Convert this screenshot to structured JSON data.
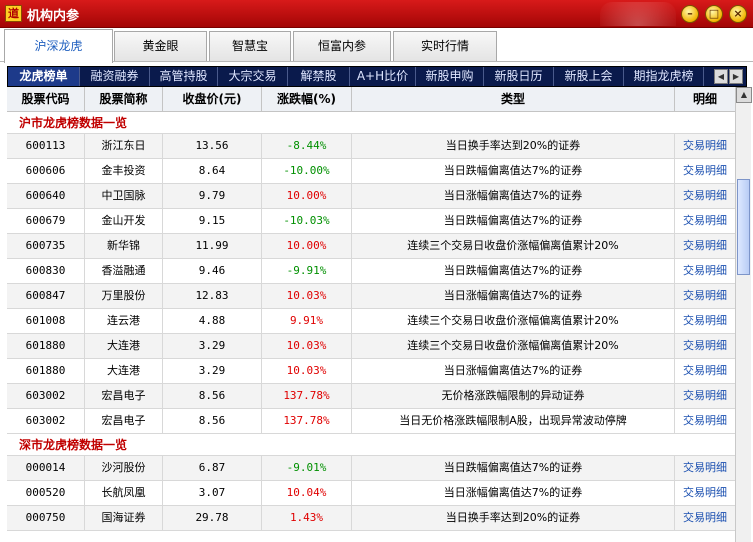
{
  "window": {
    "icon_glyph": "道",
    "title": "机构内参",
    "controls": [
      "–",
      "□",
      "×"
    ]
  },
  "top_tabs": [
    {
      "label": "沪深龙虎",
      "active": true
    },
    {
      "label": "黄金眼",
      "active": false
    },
    {
      "label": "智慧宝",
      "active": false
    },
    {
      "label": "恒富内参",
      "active": false
    },
    {
      "label": "实时行情",
      "active": false
    }
  ],
  "sub_tabs": [
    {
      "label": "龙虎榜单",
      "active": true
    },
    {
      "label": "融资融券",
      "active": false
    },
    {
      "label": "高管持股",
      "active": false
    },
    {
      "label": "大宗交易",
      "active": false
    },
    {
      "label": "解禁股",
      "active": false
    },
    {
      "label": "A+H比价",
      "active": false
    },
    {
      "label": "新股申购",
      "active": false
    },
    {
      "label": "新股日历",
      "active": false
    },
    {
      "label": "新股上会",
      "active": false
    },
    {
      "label": "期指龙虎榜",
      "active": false
    }
  ],
  "sub_tabs_scroll": {
    "left": "◀",
    "right": "▶"
  },
  "table": {
    "columns": [
      "股票代码",
      "股票简称",
      "收盘价(元)",
      "涨跌幅(%)",
      "类型",
      "明细"
    ],
    "sections": [
      {
        "title": "沪市龙虎榜数据一览",
        "rows": [
          {
            "code": "600113",
            "name": "浙江东日",
            "price": "13.56",
            "change": "-8.44%",
            "dir": "down",
            "type": "当日换手率达到20%的证券",
            "detail": "交易明细"
          },
          {
            "code": "600606",
            "name": "金丰投资",
            "price": "8.64",
            "change": "-10.00%",
            "dir": "down",
            "type": "当日跌幅偏离值达7%的证券",
            "detail": "交易明细"
          },
          {
            "code": "600640",
            "name": "中卫国脉",
            "price": "9.79",
            "change": "10.00%",
            "dir": "up",
            "type": "当日涨幅偏离值达7%的证券",
            "detail": "交易明细"
          },
          {
            "code": "600679",
            "name": "金山开发",
            "price": "9.15",
            "change": "-10.03%",
            "dir": "down",
            "type": "当日跌幅偏离值达7%的证券",
            "detail": "交易明细"
          },
          {
            "code": "600735",
            "name": "新华锦",
            "price": "11.99",
            "change": "10.00%",
            "dir": "up",
            "type": "连续三个交易日收盘价涨幅偏离值累计20%",
            "detail": "交易明细"
          },
          {
            "code": "600830",
            "name": "香溢融通",
            "price": "9.46",
            "change": "-9.91%",
            "dir": "down",
            "type": "当日跌幅偏离值达7%的证券",
            "detail": "交易明细"
          },
          {
            "code": "600847",
            "name": "万里股份",
            "price": "12.83",
            "change": "10.03%",
            "dir": "up",
            "type": "当日涨幅偏离值达7%的证券",
            "detail": "交易明细"
          },
          {
            "code": "601008",
            "name": "连云港",
            "price": "4.88",
            "change": "9.91%",
            "dir": "up",
            "type": "连续三个交易日收盘价涨幅偏离值累计20%",
            "detail": "交易明细"
          },
          {
            "code": "601880",
            "name": "大连港",
            "price": "3.29",
            "change": "10.03%",
            "dir": "up",
            "type": "连续三个交易日收盘价涨幅偏离值累计20%",
            "detail": "交易明细"
          },
          {
            "code": "601880",
            "name": "大连港",
            "price": "3.29",
            "change": "10.03%",
            "dir": "up",
            "type": "当日涨幅偏离值达7%的证券",
            "detail": "交易明细"
          },
          {
            "code": "603002",
            "name": "宏昌电子",
            "price": "8.56",
            "change": "137.78%",
            "dir": "up",
            "type": "无价格涨跌幅限制的异动证券",
            "detail": "交易明细"
          },
          {
            "code": "603002",
            "name": "宏昌电子",
            "price": "8.56",
            "change": "137.78%",
            "dir": "up",
            "type": "当日无价格涨跌幅限制A股，出现异常波动停牌",
            "detail": "交易明细"
          }
        ]
      },
      {
        "title": "深市龙虎榜数据一览",
        "rows": [
          {
            "code": "000014",
            "name": "沙河股份",
            "price": "6.87",
            "change": "-9.01%",
            "dir": "down",
            "type": "当日跌幅偏离值达7%的证券",
            "detail": "交易明细"
          },
          {
            "code": "000520",
            "name": "长航凤凰",
            "price": "3.07",
            "change": "10.04%",
            "dir": "up",
            "type": "当日涨幅偏离值达7%的证券",
            "detail": "交易明细"
          },
          {
            "code": "000750",
            "name": "国海证券",
            "price": "29.78",
            "change": "1.43%",
            "dir": "up",
            "type": "当日换手率达到20%的证券",
            "detail": "交易明细"
          }
        ]
      }
    ]
  },
  "scrollbar": {
    "up": "▲",
    "down": "▼"
  },
  "colors": {
    "titlebar": "#c41010",
    "subtab_bar": "#0a1a4c",
    "up": "#e00000",
    "down": "#009000",
    "link": "#1a4fb0",
    "section": "#c00000"
  }
}
